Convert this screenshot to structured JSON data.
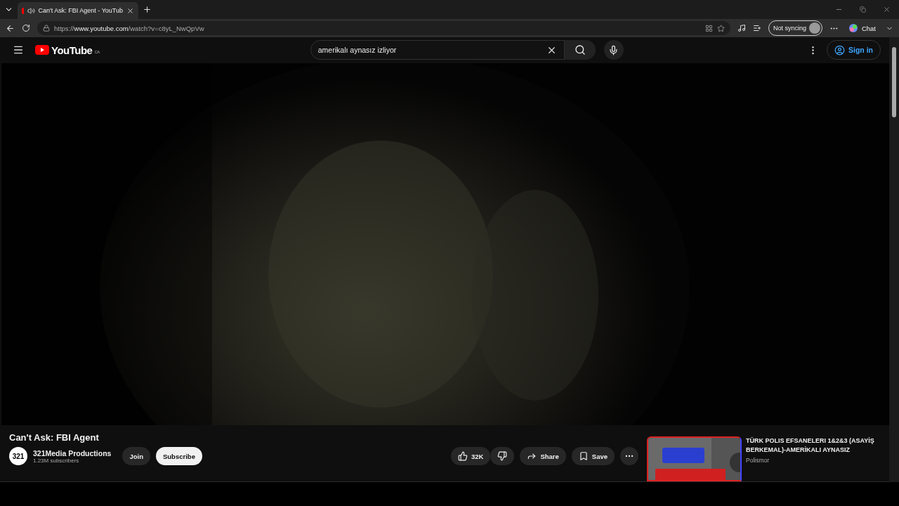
{
  "browser": {
    "tab": {
      "title": "Can't Ask: FBI Agent - YouTub",
      "selected": true
    },
    "url_scheme": "https://",
    "url_host": "www.youtube.com",
    "url_path": "/watch?v=c8yL_NwQpVw",
    "profile": "Not syncing",
    "chat": "Chat"
  },
  "header": {
    "logo": "YouTube",
    "region": "CA",
    "search": {
      "value": "amerikalı aynasız izliyor"
    },
    "sign_in": "Sign in"
  },
  "info": {
    "title": "Can't Ask: FBI Agent",
    "channel": {
      "avatar": "321",
      "name": "321Media Productions",
      "subscribers": "1.23M subscribers"
    },
    "join": "Join",
    "subscribe": "Subscribe",
    "likes": "32K",
    "share": "Share",
    "save": "Save"
  },
  "recommended": [
    {
      "title": "TÜRK POLIS EFSANELERI 1&2&3 (ASAYİŞ BERKEMAL)-AMERİKALI AYNASIZ",
      "channel": "Polismor"
    }
  ]
}
